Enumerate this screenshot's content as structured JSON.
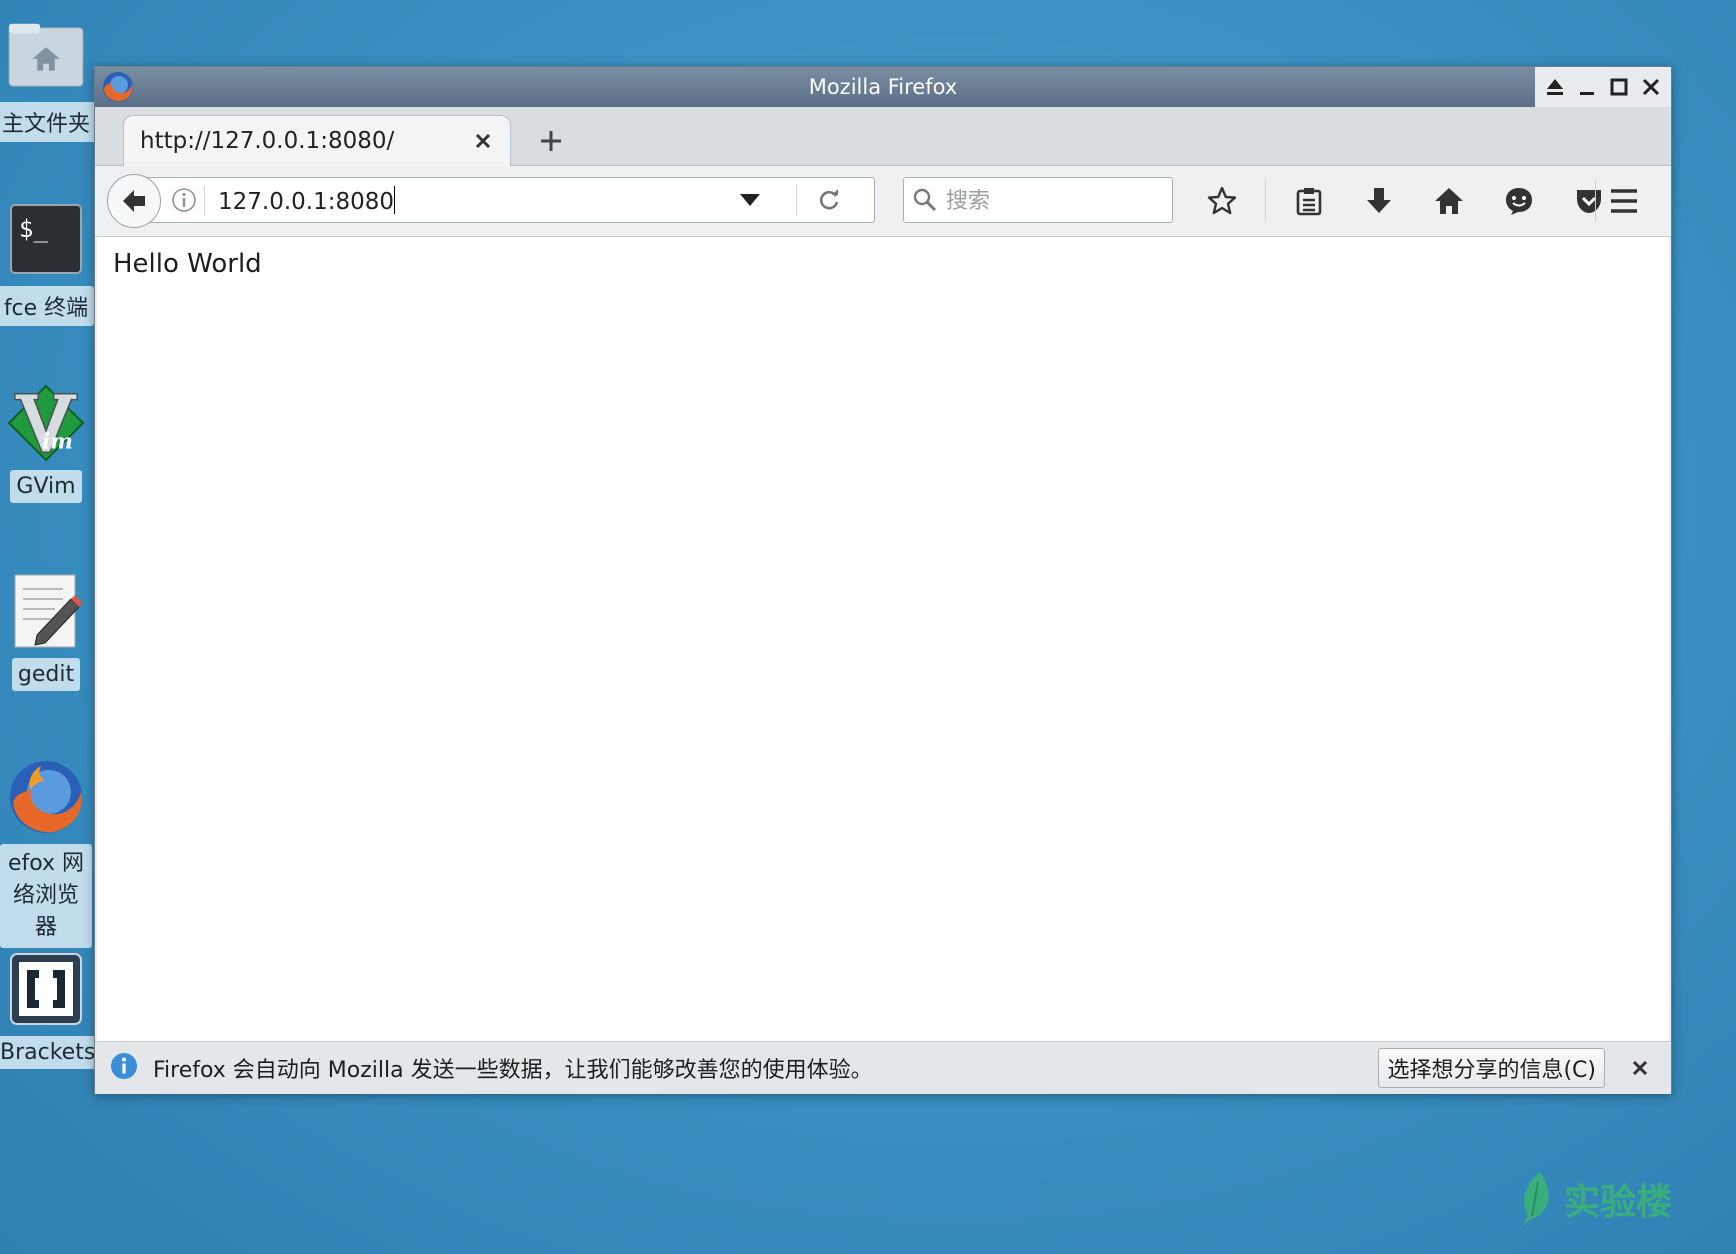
{
  "desktop": {
    "icons": [
      {
        "label": "主文件夹"
      },
      {
        "label": "fce 终端"
      },
      {
        "label": "GVim"
      },
      {
        "label": "gedit"
      },
      {
        "label": "efox 网络浏览器"
      },
      {
        "label": "Brackets"
      }
    ]
  },
  "window": {
    "title": "Mozilla Firefox"
  },
  "tabs": [
    {
      "label": "http://127.0.0.1:8080/"
    }
  ],
  "navbar": {
    "url": "127.0.0.1:8080",
    "search_placeholder": "搜索"
  },
  "content": {
    "text": "Hello World"
  },
  "notification": {
    "message": "Firefox 会自动向 Mozilla 发送一些数据，让我们能够改善您的使用体验。",
    "button_label": "选择想分享的信息(C)"
  },
  "watermark": {
    "text": "实验楼"
  },
  "colors": {
    "desktop_bg": "#3a92c4",
    "titlebar": "#5b6f86",
    "watermark": "#3dbb6a"
  }
}
